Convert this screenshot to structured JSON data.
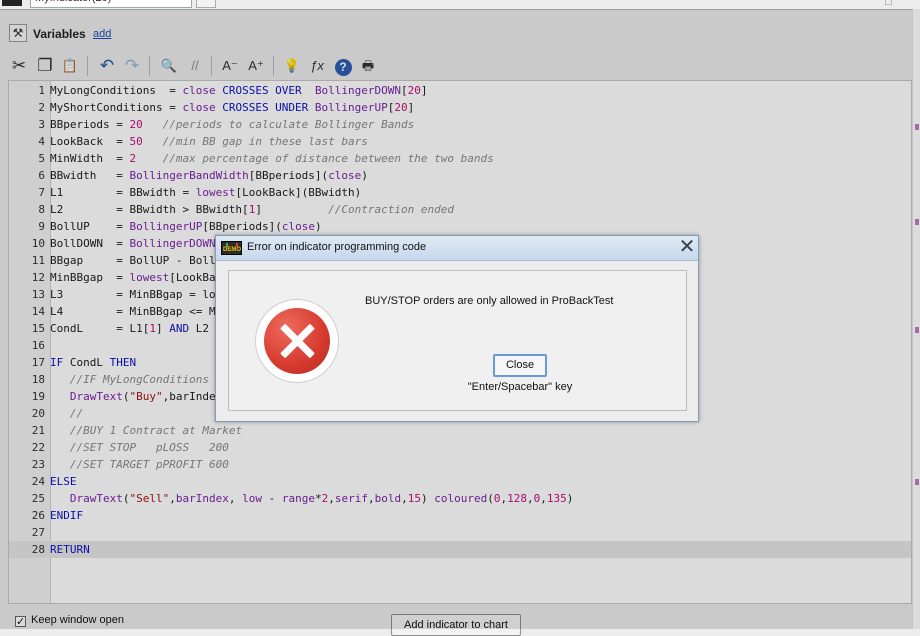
{
  "window": {
    "tab_title": "MyIndicator(20)",
    "top_right_glyph": "□"
  },
  "variables": {
    "title": "Variables",
    "add_link": "add"
  },
  "toolbar": {
    "buttons": [
      {
        "name": "cut-icon",
        "glyph": "✂"
      },
      {
        "name": "copy-icon",
        "glyph": "❐"
      },
      {
        "name": "paste-icon",
        "glyph": "📋"
      },
      {
        "name": "undo-icon",
        "glyph": "↶"
      },
      {
        "name": "redo-icon",
        "glyph": "↷"
      },
      {
        "name": "search-icon",
        "glyph": "🔍"
      },
      {
        "name": "comment-icon",
        "glyph": "//"
      },
      {
        "name": "decrease-font-icon",
        "glyph": "A⁻"
      },
      {
        "name": "increase-font-icon",
        "glyph": "A⁺"
      },
      {
        "name": "bulb-icon",
        "glyph": "💡"
      },
      {
        "name": "function-icon",
        "glyph": "ƒx"
      },
      {
        "name": "help-icon",
        "glyph": "?"
      },
      {
        "name": "print-icon",
        "glyph": "🖶"
      }
    ]
  },
  "colors": {
    "keyword": "#1010c8",
    "function": "#7a24a8",
    "number": "#c4107d",
    "comment": "#8a8a8a",
    "string": "#a31515",
    "plain": "#202020",
    "dialog_border": "#7f9db9",
    "error_red": "#d63a2e"
  },
  "editor": {
    "current_line": 28,
    "lines": [
      {
        "n": "1",
        "t": [
          [
            "p",
            "MyLongConditions  = "
          ],
          [
            "f",
            "close"
          ],
          [
            "p",
            " "
          ],
          [
            "k",
            "CROSSES OVER"
          ],
          [
            "p",
            "  "
          ],
          [
            "f",
            "BollingerDOWN"
          ],
          [
            "p",
            "["
          ],
          [
            "n",
            "20"
          ],
          [
            "p",
            "]"
          ]
        ]
      },
      {
        "n": "2",
        "t": [
          [
            "p",
            "MyShortConditions = "
          ],
          [
            "f",
            "close"
          ],
          [
            "p",
            " "
          ],
          [
            "k",
            "CROSSES UNDER"
          ],
          [
            "p",
            " "
          ],
          [
            "f",
            "BollingerUP"
          ],
          [
            "p",
            "["
          ],
          [
            "n",
            "20"
          ],
          [
            "p",
            "]"
          ]
        ]
      },
      {
        "n": "3",
        "t": [
          [
            "p",
            "BBperiods = "
          ],
          [
            "n",
            "20"
          ],
          [
            "p",
            "   "
          ],
          [
            "c",
            "//periods to calculate Bollinger Bands"
          ]
        ]
      },
      {
        "n": "4",
        "t": [
          [
            "p",
            "LookBack  = "
          ],
          [
            "n",
            "50"
          ],
          [
            "p",
            "   "
          ],
          [
            "c",
            "//min BB gap in these last bars"
          ]
        ]
      },
      {
        "n": "5",
        "t": [
          [
            "p",
            "MinWidth  = "
          ],
          [
            "n",
            "2"
          ],
          [
            "p",
            "    "
          ],
          [
            "c",
            "//max percentage of distance between the two bands"
          ]
        ]
      },
      {
        "n": "6",
        "t": [
          [
            "p",
            "BBwidth   = "
          ],
          [
            "f",
            "BollingerBandWidth"
          ],
          [
            "p",
            "[BBperiods]("
          ],
          [
            "f",
            "close"
          ],
          [
            "p",
            ")"
          ]
        ]
      },
      {
        "n": "7",
        "t": [
          [
            "p",
            "L1        = BBwidth = "
          ],
          [
            "f",
            "lowest"
          ],
          [
            "p",
            "[LookBack](BBwidth)"
          ]
        ]
      },
      {
        "n": "8",
        "t": [
          [
            "p",
            "L2        = BBwidth > BBwidth["
          ],
          [
            "n",
            "1"
          ],
          [
            "p",
            "]          "
          ],
          [
            "c",
            "//Contraction ended"
          ]
        ]
      },
      {
        "n": "9",
        "t": [
          [
            "p",
            "BollUP    = "
          ],
          [
            "f",
            "BollingerUP"
          ],
          [
            "p",
            "[BBperiods]("
          ],
          [
            "f",
            "close"
          ],
          [
            "p",
            ")"
          ]
        ]
      },
      {
        "n": "10",
        "t": [
          [
            "p",
            "BollDOWN  = "
          ],
          [
            "f",
            "BollingerDOWN"
          ],
          [
            "p",
            "[BBperiods]("
          ],
          [
            "f",
            "close"
          ],
          [
            "p",
            ")"
          ]
        ]
      },
      {
        "n": "11",
        "t": [
          [
            "p",
            "BBgap     = BollUP - BollDOWN"
          ]
        ]
      },
      {
        "n": "12",
        "t": [
          [
            "p",
            "MinBBgap  = "
          ],
          [
            "f",
            "lowest"
          ],
          [
            "p",
            "[LookBack](BBgap)"
          ]
        ]
      },
      {
        "n": "13",
        "t": [
          [
            "p",
            "L3        = MinBBgap = lowest"
          ]
        ]
      },
      {
        "n": "14",
        "t": [
          [
            "p",
            "L4        = MinBBgap <= MinWidth"
          ]
        ]
      },
      {
        "n": "15",
        "t": [
          [
            "p",
            "CondL     = L1["
          ],
          [
            "n",
            "1"
          ],
          [
            "p",
            "] "
          ],
          [
            "k",
            "AND"
          ],
          [
            "p",
            " L2"
          ]
        ]
      },
      {
        "n": "16",
        "t": []
      },
      {
        "n": "17",
        "t": [
          [
            "k",
            "IF"
          ],
          [
            "p",
            " CondL "
          ],
          [
            "k",
            "THEN"
          ]
        ]
      },
      {
        "n": "18",
        "t": [
          [
            "p",
            "   "
          ],
          [
            "c",
            "//IF MyLongConditions THEN"
          ]
        ]
      },
      {
        "n": "19",
        "t": [
          [
            "p",
            "   "
          ],
          [
            "f",
            "DrawText"
          ],
          [
            "p",
            "("
          ],
          [
            "s",
            "\"Buy\""
          ],
          [
            "p",
            ",barIndex, low - range"
          ]
        ]
      },
      {
        "n": "20",
        "t": [
          [
            "p",
            "   "
          ],
          [
            "c",
            "//"
          ]
        ]
      },
      {
        "n": "21",
        "t": [
          [
            "p",
            "   "
          ],
          [
            "c",
            "//BUY 1 Contract at Market"
          ]
        ]
      },
      {
        "n": "22",
        "t": [
          [
            "p",
            "   "
          ],
          [
            "c",
            "//SET STOP   pLOSS   200"
          ]
        ]
      },
      {
        "n": "23",
        "t": [
          [
            "p",
            "   "
          ],
          [
            "c",
            "//SET TARGET pPROFIT 600"
          ]
        ]
      },
      {
        "n": "24",
        "t": [
          [
            "k",
            "ELSE"
          ]
        ]
      },
      {
        "n": "25",
        "t": [
          [
            "p",
            "   "
          ],
          [
            "f",
            "DrawText"
          ],
          [
            "p",
            "("
          ],
          [
            "s",
            "\"Sell\""
          ],
          [
            "p",
            ","
          ],
          [
            "f",
            "barIndex"
          ],
          [
            "p",
            ", "
          ],
          [
            "f",
            "low"
          ],
          [
            "p",
            " - "
          ],
          [
            "f",
            "range"
          ],
          [
            "p",
            "*"
          ],
          [
            "n",
            "2"
          ],
          [
            "p",
            ","
          ],
          [
            "f",
            "serif"
          ],
          [
            "p",
            ","
          ],
          [
            "f",
            "bold"
          ],
          [
            "p",
            ","
          ],
          [
            "n",
            "15"
          ],
          [
            "p",
            ") "
          ],
          [
            "f",
            "coloured"
          ],
          [
            "p",
            "("
          ],
          [
            "n",
            "0"
          ],
          [
            "p",
            ","
          ],
          [
            "n",
            "128"
          ],
          [
            "p",
            ","
          ],
          [
            "n",
            "0"
          ],
          [
            "p",
            ","
          ],
          [
            "n",
            "135"
          ],
          [
            "p",
            ")"
          ]
        ]
      },
      {
        "n": "26",
        "t": [
          [
            "k",
            "ENDIF"
          ]
        ]
      },
      {
        "n": "27",
        "t": []
      },
      {
        "n": "28",
        "t": [
          [
            "k",
            "RETURN"
          ]
        ]
      }
    ]
  },
  "bottom": {
    "keep_open_label": "Keep window open",
    "add_button_label": "Add indicator to chart"
  },
  "dialog": {
    "title": "Error on indicator programming code",
    "close_glyph": "✕",
    "message": "BUY/STOP orders are only allowed in ProBackTest",
    "button_label": "Close",
    "key_hint": "\"Enter/Spacebar\" key",
    "badge_text": "DEMO"
  }
}
